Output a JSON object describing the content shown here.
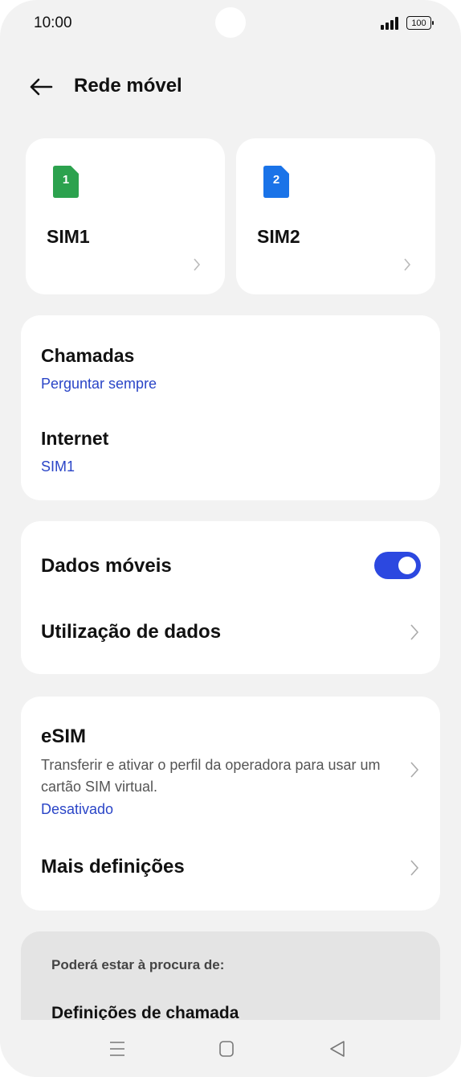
{
  "status_bar": {
    "time": "10:00",
    "battery": "100"
  },
  "header": {
    "title": "Rede móvel"
  },
  "sim_cards": [
    {
      "number": "1",
      "name": "SIM1",
      "color": "#2ca24e"
    },
    {
      "number": "2",
      "name": "SIM2",
      "color": "#1a73e8"
    }
  ],
  "preferences": {
    "calls": {
      "label": "Chamadas",
      "value": "Perguntar sempre"
    },
    "internet": {
      "label": "Internet",
      "value": "SIM1"
    }
  },
  "data": {
    "mobile_data_label": "Dados móveis",
    "mobile_data_on": true,
    "usage_label": "Utilização de dados"
  },
  "esim": {
    "title": "eSIM",
    "description": "Transferir e ativar o perfil da operadora para usar um cartão SIM virtual.",
    "status": "Desativado",
    "more_settings": "Mais definições"
  },
  "suggestions": {
    "heading": "Poderá estar à procura de:",
    "item": "Definições de chamada"
  },
  "colors": {
    "accent": "#2c48e0",
    "link": "#2a45c7",
    "background": "#f2f2f2"
  },
  "icons": [
    "back-arrow-icon",
    "sim-card-icon",
    "chevron-right-icon",
    "signal-icon",
    "battery-icon",
    "menu-icon",
    "home-icon",
    "back-triangle-icon"
  ]
}
